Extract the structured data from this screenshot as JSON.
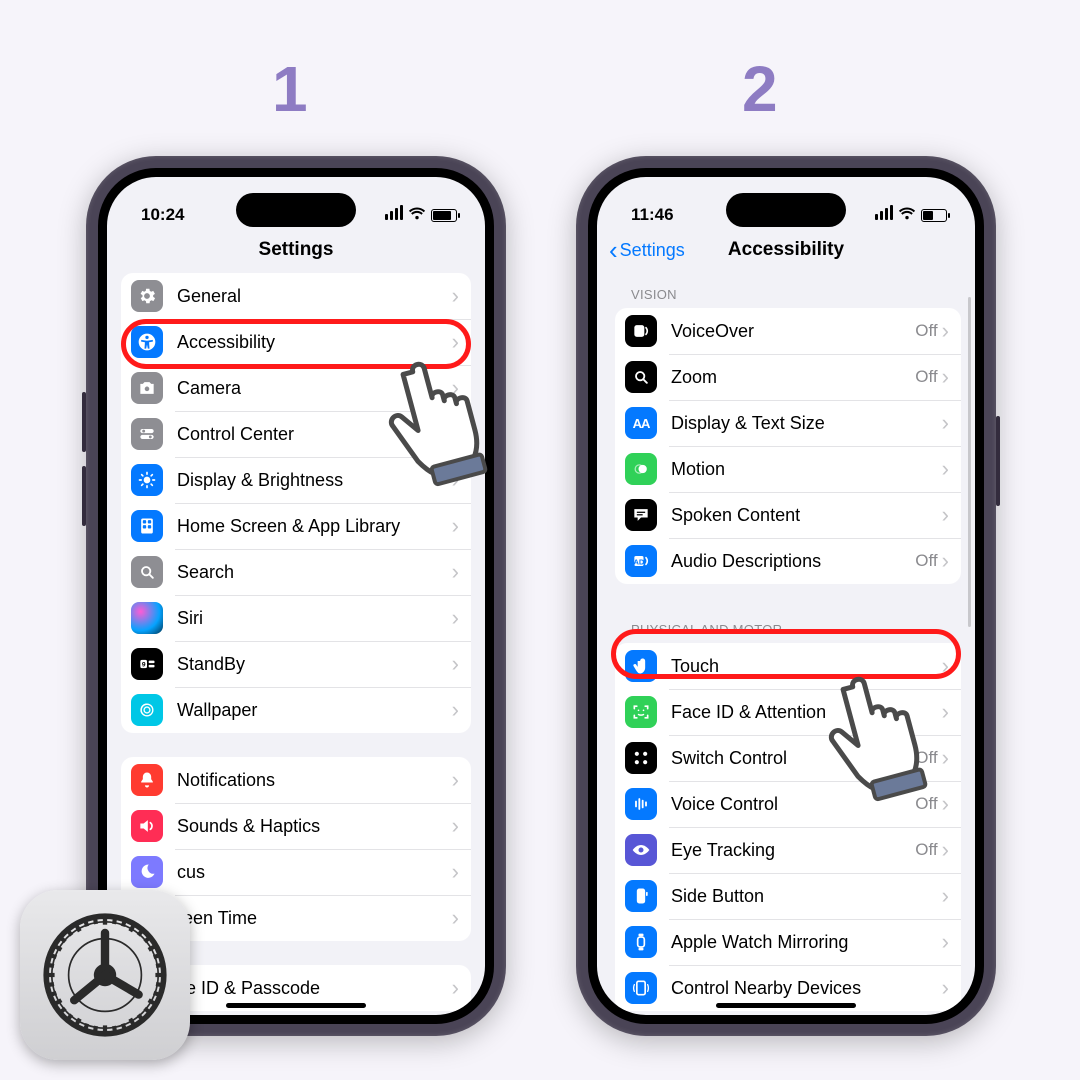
{
  "steps": {
    "one": "1",
    "two": "2"
  },
  "phone1": {
    "time": "10:24",
    "title": "Settings",
    "rows": [
      {
        "label": "General"
      },
      {
        "label": "Accessibility"
      },
      {
        "label": "Camera"
      },
      {
        "label": "Control Center"
      },
      {
        "label": "Display & Brightness"
      },
      {
        "label": "Home Screen & App Library"
      },
      {
        "label": "Search"
      },
      {
        "label": "Siri"
      },
      {
        "label": "StandBy"
      },
      {
        "label": "Wallpaper"
      }
    ],
    "rows2": [
      {
        "label": "Notifications"
      },
      {
        "label": "Sounds & Haptics"
      },
      {
        "label": "Focus",
        "trunc": "cus"
      },
      {
        "label": "Screen Time",
        "trunc": "reen Time"
      }
    ],
    "rows3": [
      {
        "label": "Face ID & Passcode",
        "trunc": "ce ID & Passcode"
      }
    ]
  },
  "phone2": {
    "time": "11:46",
    "back": "Settings",
    "title": "Accessibility",
    "hdr1": "Vision",
    "vision": [
      {
        "label": "VoiceOver",
        "value": "Off"
      },
      {
        "label": "Zoom",
        "value": "Off"
      },
      {
        "label": "Display & Text Size"
      },
      {
        "label": "Motion"
      },
      {
        "label": "Spoken Content"
      },
      {
        "label": "Audio Descriptions",
        "value": "Off"
      }
    ],
    "hdr2": "Physical and Motor",
    "motor": [
      {
        "label": "Touch"
      },
      {
        "label": "Face ID & Attention"
      },
      {
        "label": "Switch Control",
        "value": "Off"
      },
      {
        "label": "Voice Control",
        "value": "Off"
      },
      {
        "label": "Eye Tracking",
        "value": "Off"
      },
      {
        "label": "Side Button"
      },
      {
        "label": "Apple Watch Mirroring"
      },
      {
        "label": "Control Nearby Devices"
      }
    ]
  }
}
